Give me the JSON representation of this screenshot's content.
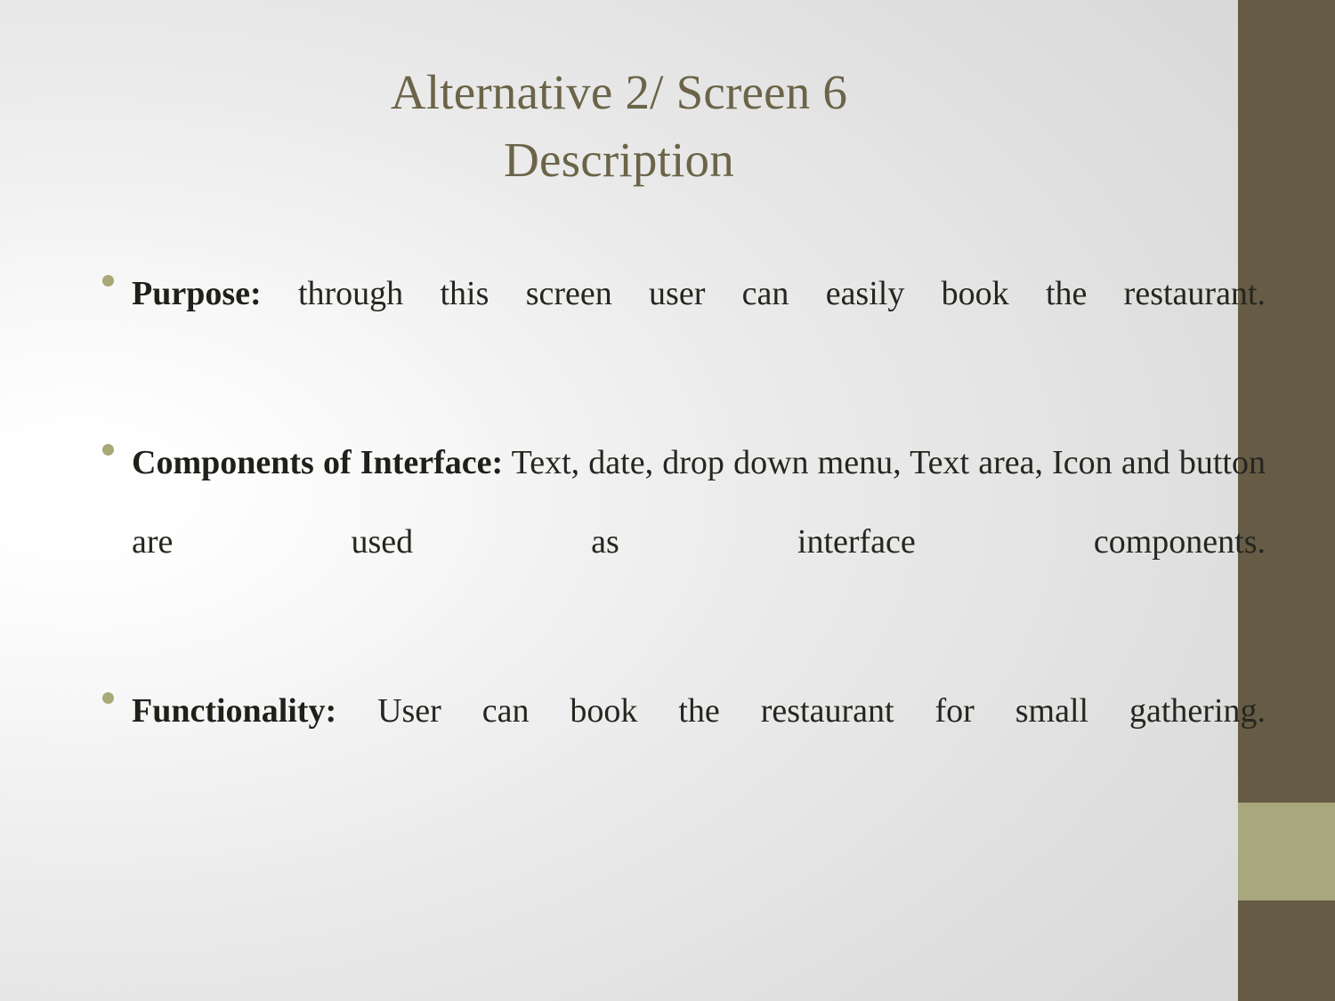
{
  "slide": {
    "title": {
      "line1": "Alternative 2/ Screen 6",
      "line2": "Description",
      "color": "#6b6448"
    },
    "bullets": [
      {
        "lead": "Purpose:",
        "body": " through this screen user can easily book the restaurant."
      },
      {
        "lead": "Components of Interface:",
        "body": " Text, date, drop down menu, Text area, Icon and button are used as interface components."
      },
      {
        "lead": "Functionality:",
        "body": " User can book the restaurant for small gathering."
      }
    ],
    "bullet_marker_color": "#a8a878",
    "decor": {
      "bar_dark_color": "#665c46",
      "bar_accent_color": "#a9a77d"
    }
  }
}
